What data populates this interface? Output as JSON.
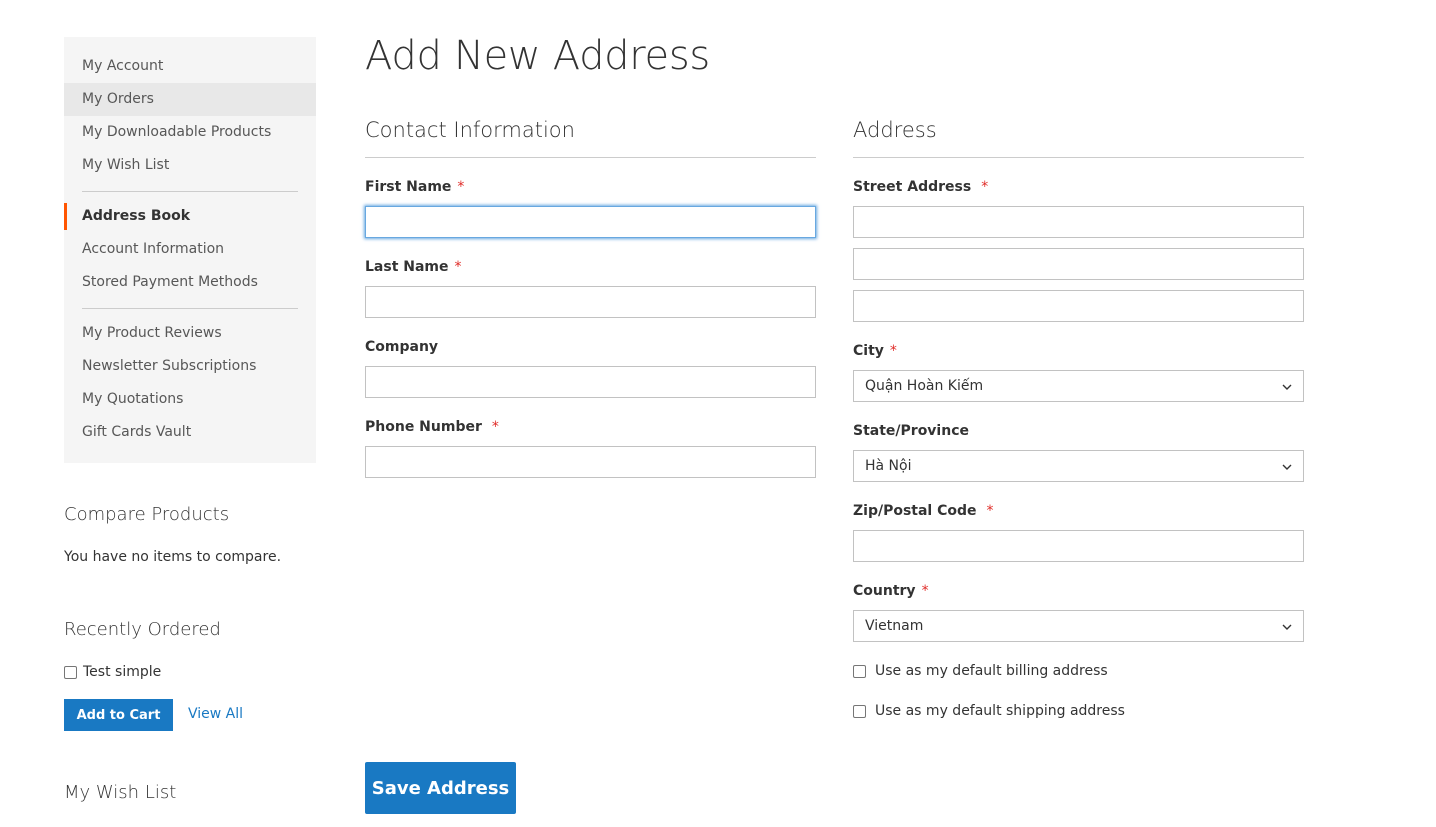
{
  "sidebar": {
    "nav_group_1": [
      {
        "label": "My Account"
      },
      {
        "label": "My Orders"
      },
      {
        "label": "My Downloadable Products"
      },
      {
        "label": "My Wish List"
      }
    ],
    "nav_group_2": [
      {
        "label": "Address Book"
      },
      {
        "label": "Account Information"
      },
      {
        "label": "Stored Payment Methods"
      }
    ],
    "nav_group_3": [
      {
        "label": "My Product Reviews"
      },
      {
        "label": "Newsletter Subscriptions"
      },
      {
        "label": "My Quotations"
      },
      {
        "label": "Gift Cards Vault"
      }
    ],
    "current_item": "Address Book",
    "compare": {
      "title": "Compare Products",
      "empty_text": "You have no items to compare."
    },
    "recently_ordered": {
      "title": "Recently Ordered",
      "item": "Test simple",
      "add_to_cart_label": "Add to Cart",
      "view_all_label": "View All"
    },
    "wishlist": {
      "title": "My Wish List"
    }
  },
  "main": {
    "page_title": "Add New Address",
    "contact": {
      "legend": "Contact Information",
      "first_name_label": "First Name",
      "last_name_label": "Last Name",
      "company_label": "Company",
      "phone_label": "Phone Number"
    },
    "address": {
      "legend": "Address",
      "street_label": "Street Address",
      "city_label": "City",
      "city_value": "Quận Hoàn Kiếm",
      "state_label": "State/Province",
      "state_value": "Hà Nội",
      "zip_label": "Zip/Postal Code",
      "country_label": "Country",
      "country_value": "Vietnam",
      "default_billing_label": "Use as my default billing address",
      "default_shipping_label": "Use as my default shipping address"
    },
    "required_marker": "*",
    "save_label": "Save Address"
  },
  "colors": {
    "primary": "#1979c3",
    "required": "#e02b27",
    "current_nav_accent": "#ff5501",
    "sidebar_bg": "#f5f5f5"
  }
}
